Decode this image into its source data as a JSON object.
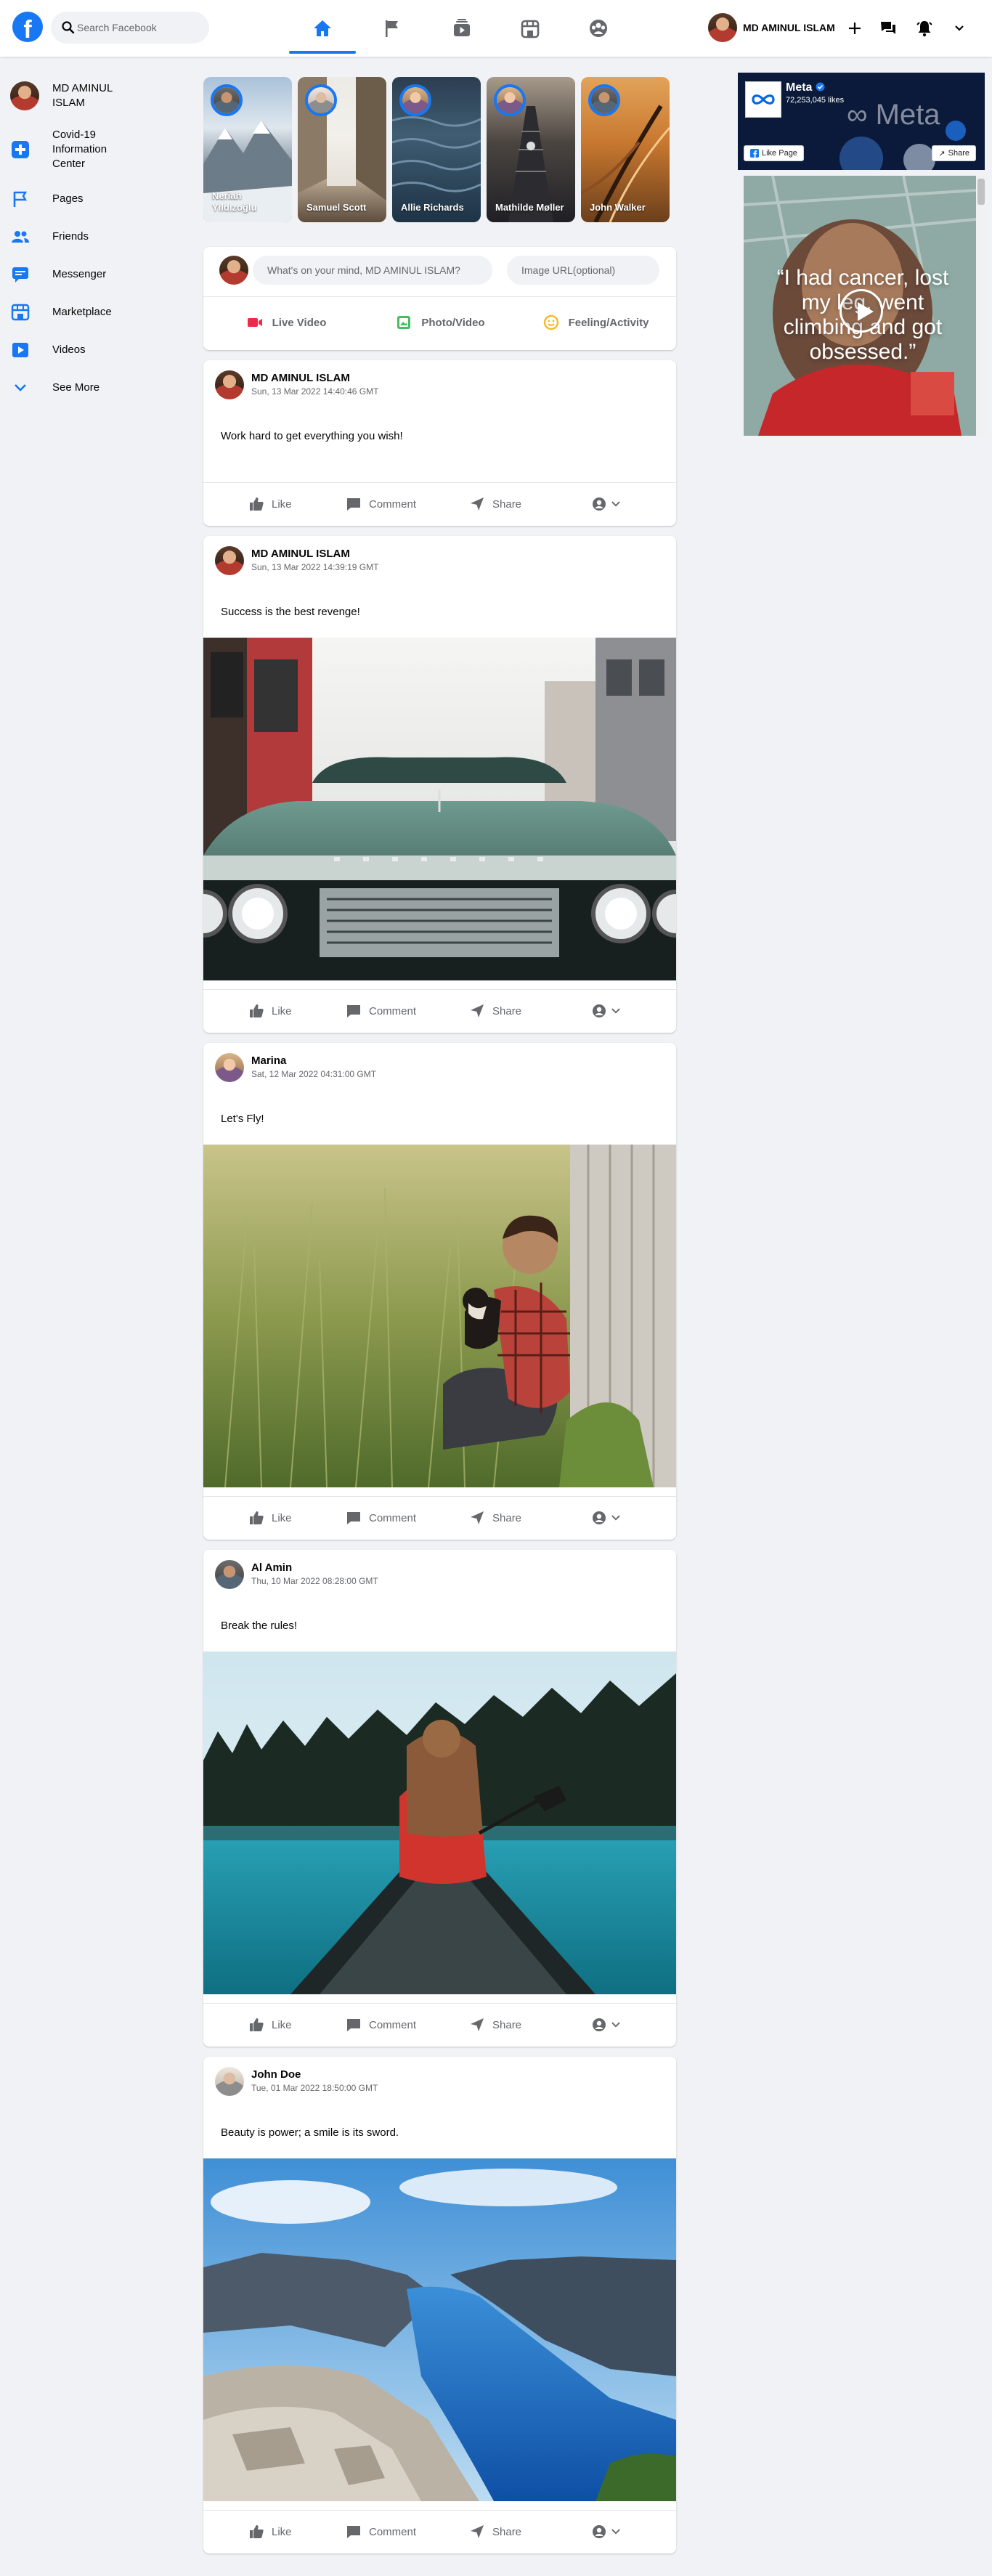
{
  "app": {
    "logo_letter": "f",
    "search": {
      "placeholder": "Search Facebook"
    },
    "user_name": "MD AMINUL ISLAM",
    "brand_color": "#1877f2"
  },
  "nav": {
    "tabs": [
      {
        "icon": "home-icon",
        "active": true
      },
      {
        "icon": "flag-icon",
        "active": false
      },
      {
        "icon": "watch-icon",
        "active": false
      },
      {
        "icon": "marketplace-icon",
        "active": false
      },
      {
        "icon": "groups-icon",
        "active": false
      }
    ],
    "right_icons": [
      "plus-icon",
      "messenger-icon",
      "notifications-icon",
      "chevron-down-icon"
    ]
  },
  "sidebar": {
    "profile_name": "MD AMINUL ISLAM",
    "items": [
      {
        "label": "Covid-19 Information Center",
        "icon": "covid-plus-icon"
      },
      {
        "label": "Pages",
        "icon": "pages-flag-icon"
      },
      {
        "label": "Friends",
        "icon": "friends-icon"
      },
      {
        "label": "Messenger",
        "icon": "messenger-icon"
      },
      {
        "label": "Marketplace",
        "icon": "marketplace-icon"
      },
      {
        "label": "Videos",
        "icon": "videos-icon"
      },
      {
        "label": "See More",
        "icon": "chevron-down-icon"
      }
    ]
  },
  "stories": [
    {
      "name": "Neriah Yıldızoğlu"
    },
    {
      "name": "Samuel Scott"
    },
    {
      "name": "Allie Richards"
    },
    {
      "name": "Mathilde Møller"
    },
    {
      "name": "John Walker"
    }
  ],
  "composer": {
    "text_placeholder": "What's on your mind, MD AMINUL ISLAM?",
    "image_placeholder": "Image URL(optional)",
    "buttons": [
      {
        "label": "Live Video",
        "icon": "live-video-icon",
        "color": "#f02849"
      },
      {
        "label": "Photo/Video",
        "icon": "photo-icon",
        "color": "#45bd62"
      },
      {
        "label": "Feeling/Activity",
        "icon": "feeling-icon",
        "color": "#f7b928"
      }
    ]
  },
  "post_actions": {
    "like": "Like",
    "comment": "Comment",
    "share": "Share"
  },
  "posts": [
    {
      "author": "MD AMINUL ISLAM",
      "time": "Sun, 13 Mar 2022 14:40:46 GMT",
      "text": "Work hard to get everything you wish!",
      "has_image": false
    },
    {
      "author": "MD AMINUL ISLAM",
      "time": "Sun, 13 Mar 2022 14:39:19 GMT",
      "text": "Success is the best revenge!",
      "has_image": true,
      "image": "green vintage car front"
    },
    {
      "author": "Marina",
      "time": "Sat, 12 Mar 2022 04:31:00 GMT",
      "text": "Let's Fly!",
      "has_image": true,
      "image": "man with dog in tall grass"
    },
    {
      "author": "Al Amin",
      "time": "Thu, 10 Mar 2022 08:28:00 GMT",
      "text": "Break the rules!",
      "has_image": true,
      "image": "woman in canoe on lake"
    },
    {
      "author": "John Doe",
      "time": "Tue, 01 Mar 2022 18:50:00 GMT",
      "text": "Beauty is power; a smile is its sword.",
      "has_image": true,
      "image": "fjord from cliff"
    }
  ],
  "sponsored": {
    "page_name": "Meta",
    "likes": "72,253,045 likes",
    "watermark": "∞ Meta",
    "like_button": "Like Page",
    "share_button": "Share",
    "video_quote": "“I had cancer, lost my leg, went climbing and got obsessed.”"
  }
}
